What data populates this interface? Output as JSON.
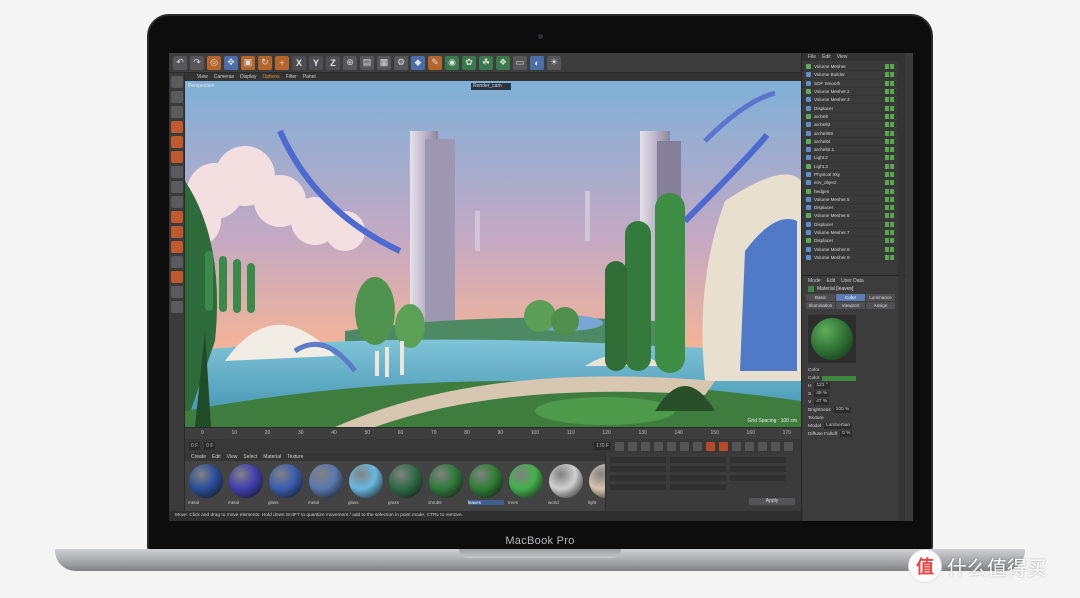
{
  "app": {
    "view_menu": [
      "View",
      "Cameras",
      "Display",
      "Options",
      "Filter",
      "Panel"
    ],
    "viewport_label": "Perspective",
    "camera_name": "Render_cam",
    "grid_spacing": "Grid Spacing : 100 cm"
  },
  "timeline": {
    "ticks": [
      "0",
      "10",
      "20",
      "30",
      "40",
      "50",
      "60",
      "70",
      "80",
      "90",
      "100",
      "110",
      "120",
      "130",
      "140",
      "150",
      "160",
      "170"
    ],
    "start_field": "0 F",
    "end_field": "170 F",
    "current_frame": "0 F"
  },
  "materials": {
    "menu": [
      "Create",
      "Edit",
      "View",
      "Select",
      "Material",
      "Texture"
    ],
    "items": [
      {
        "label": "metal",
        "color": "#2a4e9a"
      },
      {
        "label": "metal",
        "color": "#4040b0"
      },
      {
        "label": "glass",
        "color": "#3a5db0"
      },
      {
        "label": "metal",
        "color": "#5a78b0"
      },
      {
        "label": "glass",
        "color": "#6ab8e0"
      },
      {
        "label": "grass",
        "color": "#2e6b45"
      },
      {
        "label": "shrubs",
        "color": "#2f7a3a"
      },
      {
        "label": "leaves",
        "color": "#2f7f33"
      },
      {
        "label": "trees",
        "color": "#44b04a"
      },
      {
        "label": "world",
        "color": "#d0d0d0"
      },
      {
        "label": "light",
        "color": "#d9c4ae"
      }
    ],
    "selected_index": 7,
    "apply_label": "Apply"
  },
  "status_text": "Move: Click and drag to move elements. Hold down SHIFT to quantize movement / add to the selection in point mode, CTRL to remove.",
  "objects": {
    "menu": [
      "File",
      "Edit",
      "View"
    ],
    "rows": [
      {
        "label": "Volume Mesher"
      },
      {
        "label": "Volume Builder"
      },
      {
        "label": "SDF Smooth"
      },
      {
        "label": "Volume Mesher.2"
      },
      {
        "label": "Volume Mesher.3"
      },
      {
        "label": "Displacer"
      },
      {
        "label": "archelt"
      },
      {
        "label": "archelt2"
      },
      {
        "label": "archelt08"
      },
      {
        "label": "archelt4"
      },
      {
        "label": "archelt2.1"
      },
      {
        "label": "Light.2"
      },
      {
        "label": "Light.3"
      },
      {
        "label": "Physical Sky"
      },
      {
        "label": "env_object"
      },
      {
        "label": "hedges"
      },
      {
        "label": "Volume Mesher.5"
      },
      {
        "label": "Displacer"
      },
      {
        "label": "Volume Mesher.6"
      },
      {
        "label": "Displacer"
      },
      {
        "label": "Volume Mesher.7"
      },
      {
        "label": "Displacer"
      },
      {
        "label": "Volume Mesher.8"
      },
      {
        "label": "Volume Mesher.9"
      }
    ]
  },
  "attributes": {
    "menu": [
      "Mode",
      "Edit",
      "User Data"
    ],
    "title": "Material [leaves]",
    "tabs": [
      "Basic",
      "Color",
      "Luminance",
      "Illumination",
      "Viewport",
      "Assign"
    ],
    "active_tab": 1,
    "section": "Color",
    "props": [
      {
        "label": "Color",
        "value": ""
      },
      {
        "label": "H",
        "value": "121 °"
      },
      {
        "label": "S",
        "value": "49 %"
      },
      {
        "label": "V",
        "value": "47 %"
      },
      {
        "label": "Brightness",
        "value": "100 %"
      },
      {
        "label": "Texture",
        "value": ""
      },
      {
        "label": "Model",
        "value": "Lambertian"
      },
      {
        "label": "Diffuse Falloff",
        "value": "0 %"
      }
    ]
  },
  "device_label": "MacBook Pro",
  "watermark": {
    "text": "什么值得买",
    "logo": "值"
  }
}
